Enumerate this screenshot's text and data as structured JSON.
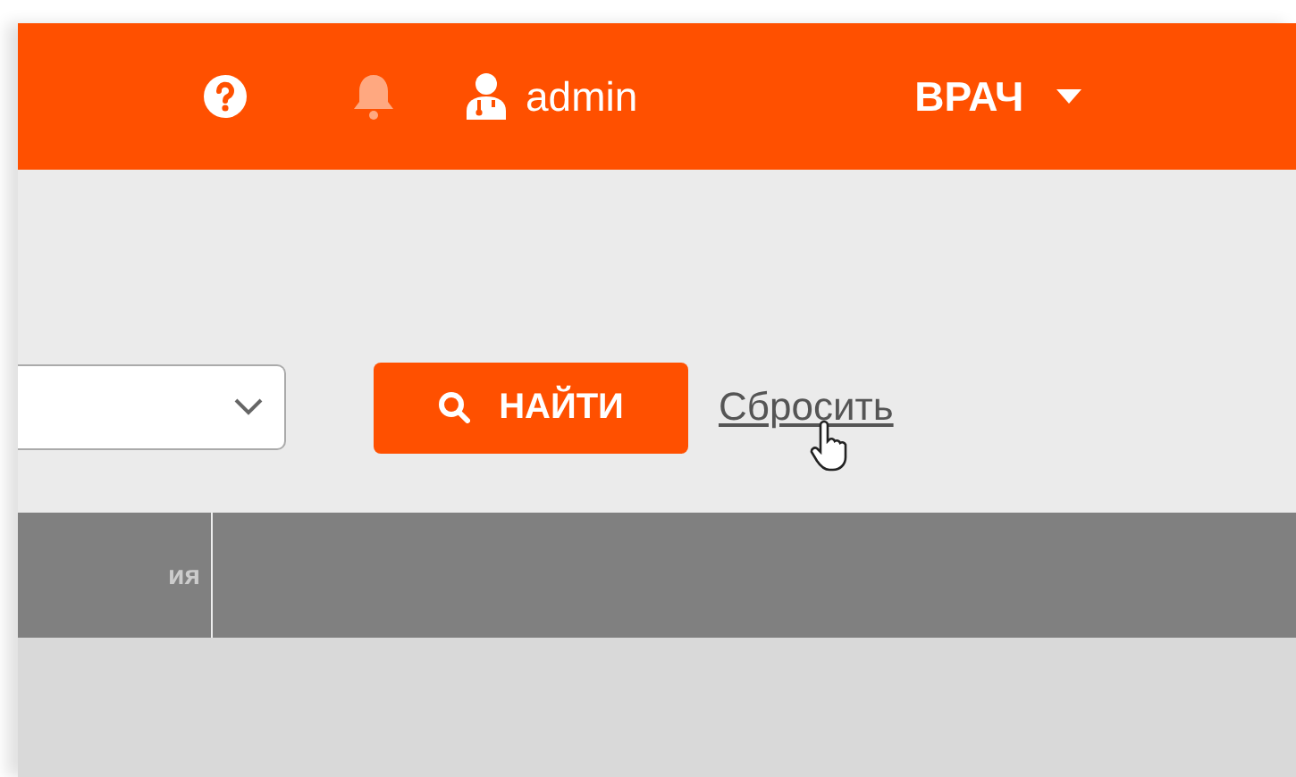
{
  "header": {
    "notifications": {
      "unread": false
    },
    "user": {
      "name": "admin"
    },
    "role": {
      "label": "ВРАЧ"
    }
  },
  "filter": {
    "search_button": {
      "label": "НАЙТИ"
    },
    "reset_link": {
      "label": "Сбросить"
    }
  },
  "table": {
    "columns": [
      "ия",
      ""
    ]
  }
}
